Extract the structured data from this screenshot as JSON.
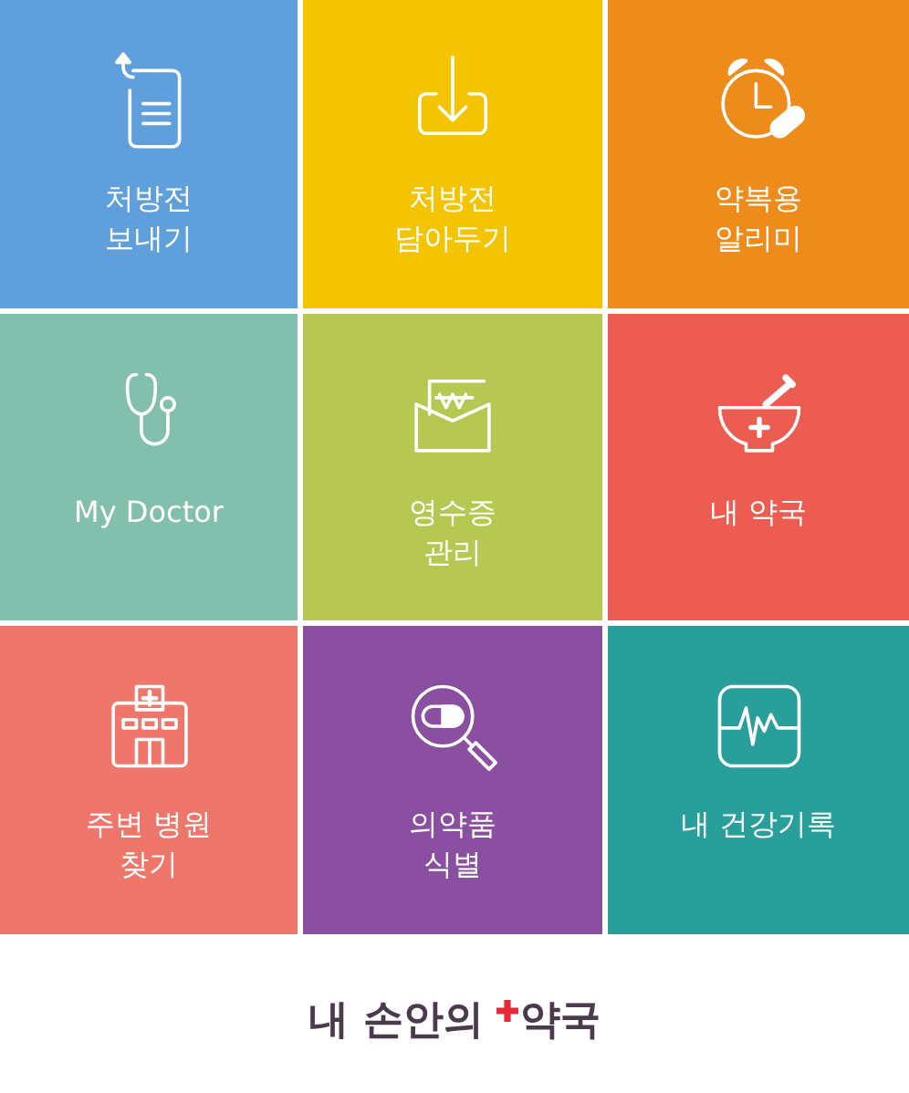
{
  "tiles": [
    {
      "kind": "send",
      "label": "처방전\n보내기",
      "color": "#5f9fdc"
    },
    {
      "kind": "download",
      "label": "처방전\n담아두기",
      "color": "#f4c401"
    },
    {
      "kind": "alarm",
      "label": "약복용\n알리미",
      "color": "#ed8c1a"
    },
    {
      "kind": "doctor",
      "label": "My Doctor",
      "color": "#83bfad"
    },
    {
      "kind": "receipt",
      "label": "영수증\n관리",
      "color": "#b7c852"
    },
    {
      "kind": "pharmacy",
      "label": "내 약국",
      "color": "#ec5c51"
    },
    {
      "kind": "hospital",
      "label": "주변 병원\n찾기",
      "color": "#ef766a"
    },
    {
      "kind": "pill",
      "label": "의약품\n식별",
      "color": "#8a4fa1"
    },
    {
      "kind": "record",
      "label": "내 건강기록",
      "color": "#289f9a"
    }
  ],
  "logo": {
    "text": "내 손안의",
    "accent": "약국"
  }
}
